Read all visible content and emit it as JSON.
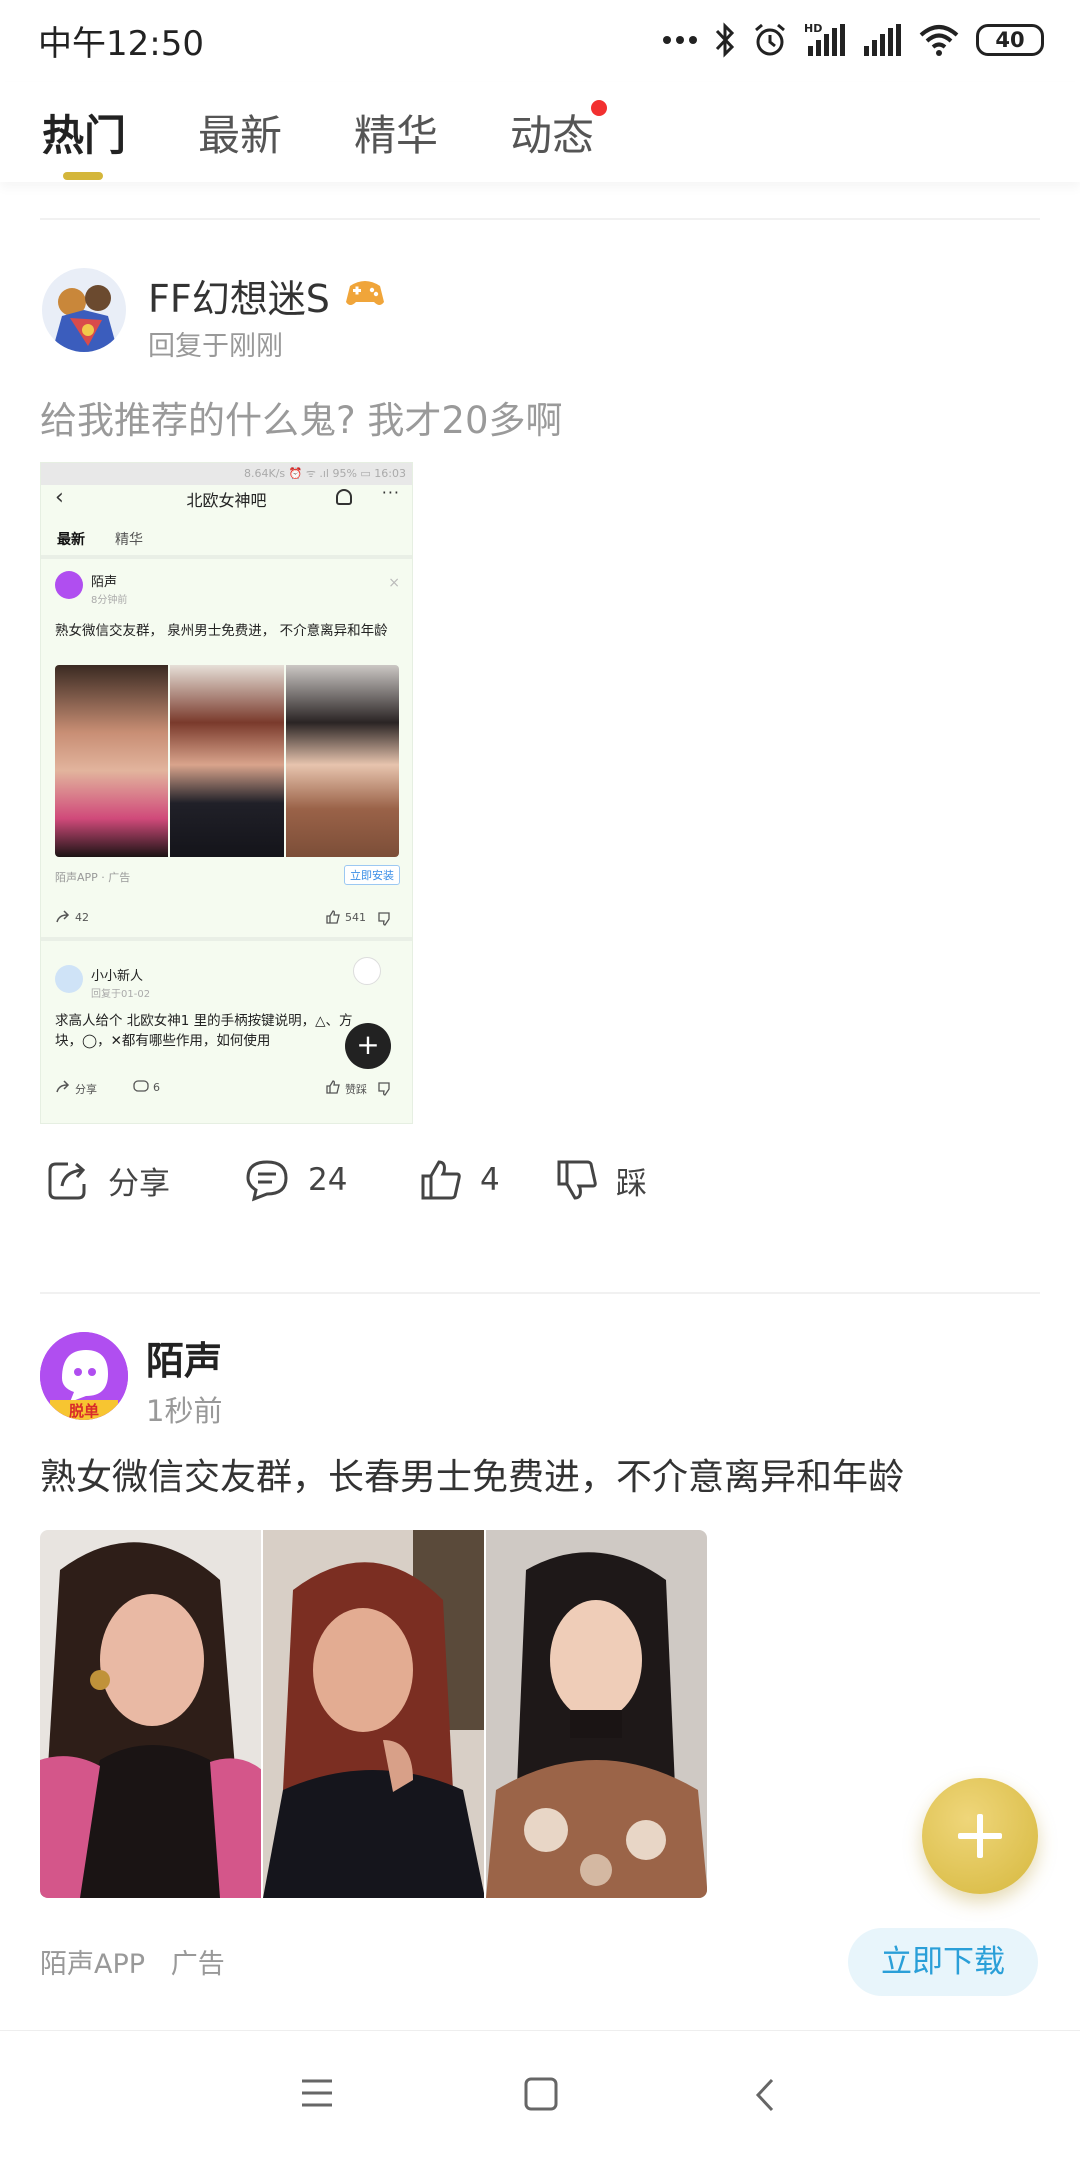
{
  "status_bar": {
    "time": "中午12:50",
    "network_label": "HD",
    "battery": "40",
    "icons": [
      "more-dots-icon",
      "bluetooth-icon",
      "alarm-icon",
      "signal-icon",
      "signal-icon",
      "wifi-icon",
      "battery-icon"
    ]
  },
  "tabs": [
    {
      "label": "热门",
      "active": true
    },
    {
      "label": "最新",
      "active": false
    },
    {
      "label": "精华",
      "active": false
    },
    {
      "label": "动态",
      "active": false,
      "badge_dot": true
    }
  ],
  "colors": {
    "accent": "#d4b63a",
    "badge": "#f23030",
    "link": "#2a9fd8"
  },
  "post1": {
    "username": "FF幻想迷S",
    "badge_icon": "gamepad-badge-icon",
    "meta": "回复于刚刚",
    "text": "给我推荐的什么鬼? 我才20多啊",
    "screenshot": {
      "status": "8.64K/s ⏰ ᯤ .ıl 95% ▭ 16:03",
      "title": "北欧女神吧",
      "tabs": [
        "最新",
        "精华"
      ],
      "ad_post": {
        "name": "陌声",
        "time": "8分钟前",
        "text": "熟女微信交友群， 泉州男士免费进， 不介意离异和年龄",
        "ad_label": "陌声APP · 广告",
        "install": "立即安装",
        "shares": "42",
        "likes": "541"
      },
      "post": {
        "name": "小小新人",
        "time": "回复于01-02",
        "text": "求高人给个 北欧女神1 里的手柄按键说明，△、方块，◯，✕都有哪些作用，如何使用",
        "share": "分享",
        "comments": "6",
        "likes": "赞踩"
      }
    },
    "actions": {
      "share": "分享",
      "comments": "24",
      "likes": "4",
      "dislike": "踩"
    }
  },
  "post2": {
    "username": "陌声",
    "avatar_badge": "脱单",
    "meta": "1秒前",
    "text": "熟女微信交友群，长春男士免费进，不介意离异和年龄",
    "ad_label": "陌声APP   广告",
    "download": "立即下载"
  },
  "nav": [
    "menu-icon",
    "home-square-icon",
    "back-chevron-icon"
  ]
}
